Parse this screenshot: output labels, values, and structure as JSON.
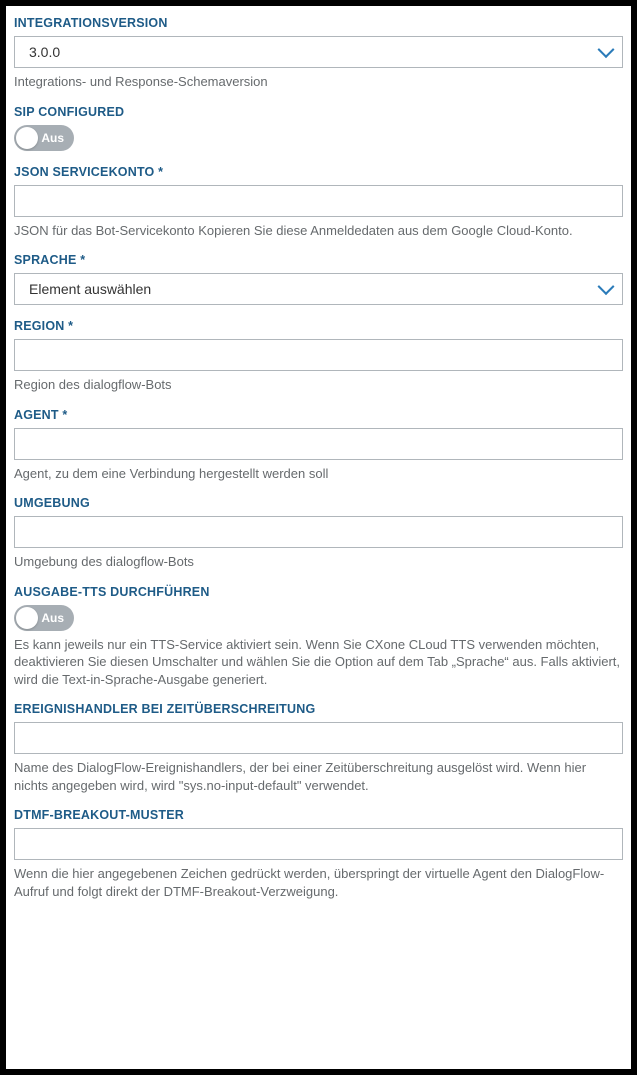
{
  "fields": {
    "integrationsversion": {
      "label": "INTEGRATIONSVERSION",
      "value": "3.0.0",
      "helper": "Integrations- und Response-Schemaversion"
    },
    "sip_configured": {
      "label": "SIP CONFIGURED",
      "toggle_text": "Aus"
    },
    "json_servicekonto": {
      "label": "JSON SERVICEKONTO *",
      "value": "",
      "helper": "JSON für das Bot-Servicekonto Kopieren Sie diese Anmeldedaten aus dem Google Cloud-Konto."
    },
    "sprache": {
      "label": "SPRACHE *",
      "value": "Element auswählen"
    },
    "region": {
      "label": "REGION *",
      "value": "",
      "helper": "Region des dialogflow-Bots"
    },
    "agent": {
      "label": "AGENT *",
      "value": "",
      "helper": "Agent, zu dem eine Verbindung hergestellt werden soll"
    },
    "umgebung": {
      "label": "UMGEBUNG",
      "value": "",
      "helper": "Umgebung des dialogflow-Bots"
    },
    "ausgabe_tts": {
      "label": "AUSGABE-TTS DURCHFÜHREN",
      "toggle_text": "Aus",
      "helper": "Es kann jeweils nur ein TTS-Service aktiviert sein. Wenn Sie CXone CLoud TTS verwenden möchten, deaktivieren Sie diesen Umschalter und wählen Sie die Option auf dem Tab „Sprache“ aus. Falls aktiviert, wird die Text-in-Sprache-Ausgabe generiert."
    },
    "ereignishandler": {
      "label": "EREIGNISHANDLER BEI ZEITÜBERSCHREITUNG",
      "value": "",
      "helper": "Name des DialogFlow-Ereignishandlers, der bei einer Zeitüberschreitung ausgelöst wird. Wenn hier nichts angegeben wird, wird \"sys.no-input-default\" verwendet."
    },
    "dtmf": {
      "label": "DTMF-BREAKOUT-MUSTER",
      "value": "",
      "helper": "Wenn die hier angegebenen Zeichen gedrückt werden, überspringt der virtuelle Agent den DialogFlow-Aufruf und folgt direkt der DTMF-Breakout-Verzweigung."
    }
  }
}
